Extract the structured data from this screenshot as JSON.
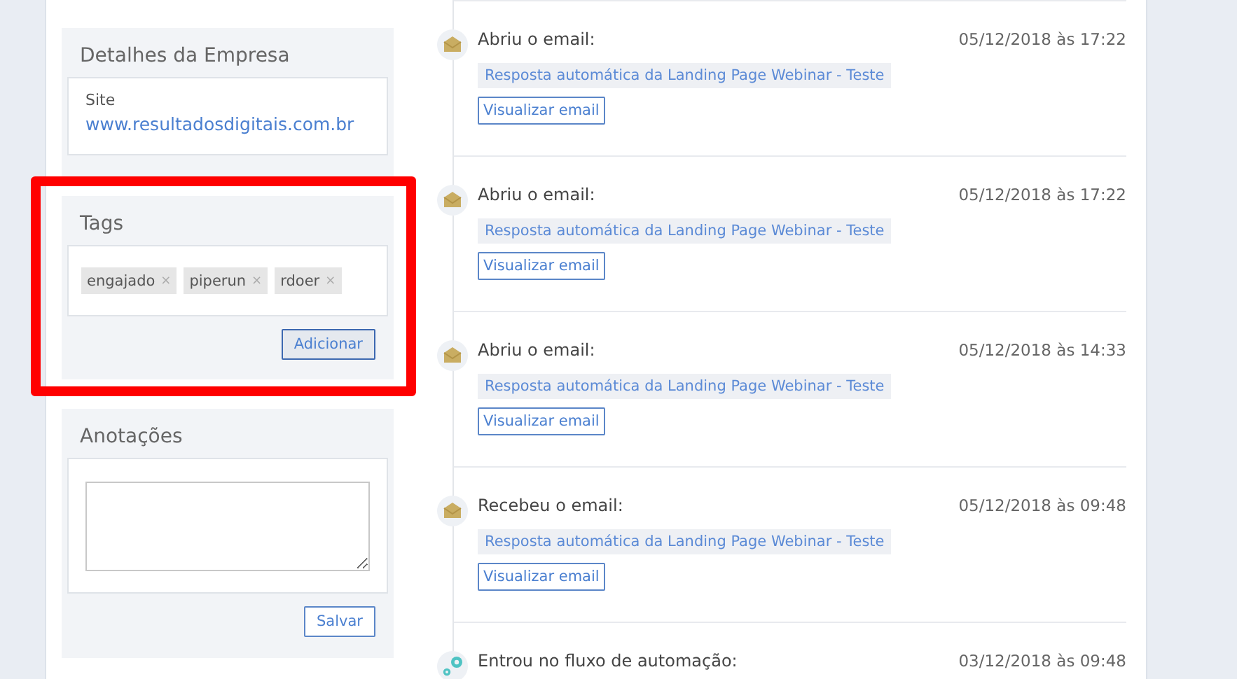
{
  "company": {
    "title": "Detalhes da Empresa",
    "site_label": "Site",
    "site_url": "www.resultadosdigitais.com.br"
  },
  "tags": {
    "title": "Tags",
    "highlighted": true,
    "items": [
      {
        "label": "engajado",
        "remove": "×"
      },
      {
        "label": "piperun",
        "remove": "×"
      },
      {
        "label": "rdoer",
        "remove": "×"
      }
    ],
    "button": "Adicionar"
  },
  "notes": {
    "title": "Anotações",
    "button": "Salvar"
  },
  "timeline": [
    {
      "kind": "email",
      "title": "Abriu o email:",
      "time": "05/12/2018 às 17:22",
      "subject": "Resposta automática da Landing Page Webinar - Teste",
      "action": "Visualizar email"
    },
    {
      "kind": "email",
      "title": "Abriu o email:",
      "time": "05/12/2018 às 17:22",
      "subject": "Resposta automática da Landing Page Webinar - Teste",
      "action": "Visualizar email"
    },
    {
      "kind": "email",
      "title": "Abriu o email:",
      "time": "05/12/2018 às 14:33",
      "subject": "Resposta automática da Landing Page Webinar - Teste",
      "action": "Visualizar email"
    },
    {
      "kind": "email",
      "title": "Recebeu o email:",
      "time": "05/12/2018 às 09:48",
      "subject": "Resposta automática da Landing Page Webinar - Teste",
      "action": "Visualizar email"
    },
    {
      "kind": "automation",
      "title": "Entrou no fluxo de automação:",
      "time": "03/12/2018 às 09:48"
    }
  ]
}
